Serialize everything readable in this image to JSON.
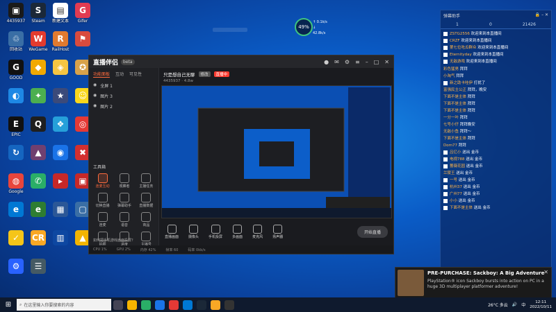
{
  "desktop_icons": [
    {
      "label": "4435937",
      "color": "#1a1a1a",
      "glyph": "▣"
    },
    {
      "label": "Steam",
      "color": "#1b2838",
      "glyph": "S"
    },
    {
      "label": "新建文本",
      "color": "#ffffff",
      "glyph": "▤"
    },
    {
      "label": "Gifer",
      "color": "#e13b52",
      "glyph": "G"
    },
    {
      "label": "回收站",
      "color": "#3a6ea5",
      "glyph": "♲"
    },
    {
      "label": "WeGame",
      "color": "#e33b2e",
      "glyph": "W"
    },
    {
      "label": "RailHost",
      "color": "#e07a2f",
      "glyph": "R"
    },
    {
      "label": "",
      "color": "#d84b3e",
      "glyph": "⚑"
    },
    {
      "label": "GOOD",
      "color": "#111111",
      "glyph": "G"
    },
    {
      "label": "",
      "color": "#f2a900",
      "glyph": "◆"
    },
    {
      "label": "",
      "color": "#f5c542",
      "glyph": "◈"
    },
    {
      "label": "",
      "color": "#d8a24a",
      "glyph": "✪"
    },
    {
      "label": "",
      "color": "#1e88e5",
      "glyph": "◐"
    },
    {
      "label": "",
      "color": "#4caf50",
      "glyph": "✦"
    },
    {
      "label": "",
      "color": "#3b4a7a",
      "glyph": "★"
    },
    {
      "label": "",
      "color": "#f9d71c",
      "glyph": "☺"
    },
    {
      "label": "EPIC",
      "color": "#111111",
      "glyph": "E"
    },
    {
      "label": "",
      "color": "#1f1f1f",
      "glyph": "Q"
    },
    {
      "label": "",
      "color": "#26a0da",
      "glyph": "❖"
    },
    {
      "label": "",
      "color": "#e53935",
      "glyph": "◎"
    },
    {
      "label": "",
      "color": "#1565c0",
      "glyph": "↻"
    },
    {
      "label": "",
      "color": "#e5393577",
      "glyph": "▲"
    },
    {
      "label": "",
      "color": "#1a73e8",
      "glyph": "◉"
    },
    {
      "label": "",
      "color": "#d32f2f",
      "glyph": "✖"
    },
    {
      "label": "Google",
      "color": "#e8453c",
      "glyph": "◍"
    },
    {
      "label": "",
      "color": "#2aae67",
      "glyph": "✆"
    },
    {
      "label": "",
      "color": "#c62828",
      "glyph": "▸"
    },
    {
      "label": "",
      "color": "#c62828",
      "glyph": "▣"
    },
    {
      "label": "",
      "color": "#0078d4",
      "glyph": "e"
    },
    {
      "label": "",
      "color": "#2e7d32",
      "glyph": "e"
    },
    {
      "label": "",
      "color": "#2b5797",
      "glyph": "▦"
    },
    {
      "label": "",
      "color": "#3a6ea5",
      "glyph": "▢"
    },
    {
      "label": "",
      "color": "#f5c518",
      "glyph": "✓"
    },
    {
      "label": "",
      "color": "#f9a825",
      "glyph": "CR"
    },
    {
      "label": "",
      "color": "#0d47a1",
      "glyph": "▥"
    },
    {
      "label": "",
      "color": "#f2b400",
      "glyph": "▲"
    },
    {
      "label": "",
      "color": "#2962ff",
      "glyph": "⚙"
    },
    {
      "label": "",
      "color": "#455a64",
      "glyph": "☰"
    }
  ],
  "perf": {
    "percent": "49%",
    "up": "↑ 0.1k/s",
    "down": "↓ 42.8k/s"
  },
  "app": {
    "logo": "直播伴侣",
    "version": "beta",
    "tabs": [
      "功能面板",
      "互动",
      "可见性"
    ],
    "scenes": [
      "全屏 1",
      "图片 3",
      "图片 2"
    ],
    "tools_title": "工具箱",
    "tools": [
      "连麦互动",
      "观察者",
      "主播任务",
      "切换直播",
      "弹幕助手",
      "直播数据",
      "连麦",
      "语音",
      "商品",
      "拍照",
      "进度",
      "主播号"
    ],
    "channel_title": "只是想自己无聊",
    "tag_live": "直播中",
    "tag_gray": "修改",
    "channel_sub": "4435937 · 4.8w",
    "bottom_buttons": [
      "直播画面",
      "摄像头",
      "手机投屏",
      "多画面",
      "麦克风",
      "扬声器"
    ],
    "start_live": "开始直播",
    "status": [
      "CPU 1%",
      "GPU 2%",
      "内存 42%",
      "帧率 60",
      "码率 0kb/s"
    ],
    "tip": "如何把手机游戏画面投屏？"
  },
  "chat": {
    "header": "弹幕助手",
    "stats": [
      "1",
      "0",
      "21426"
    ],
    "messages": [
      {
        "user": "ZSTG2556",
        "text": "欢迎来到本直播间",
        "sq": true
      },
      {
        "user": "CRZF",
        "text": "欢迎来到本直播间",
        "sq": true
      },
      {
        "user": "第七位吃瓜群众",
        "text": "欢迎来到本直播间",
        "sq": true
      },
      {
        "user": "Eternityday",
        "text": "欢迎来到本直播间",
        "sq": true
      },
      {
        "user": "无敌游戏",
        "text": "欢迎来到本直播间",
        "sq": true
      },
      {
        "user": "",
        "text": "",
        "sq": false
      },
      {
        "user": "彩色猛男",
        "text": "拜拜",
        "sq": false
      },
      {
        "user": "小淘气",
        "text": "拜拜",
        "sq": false
      },
      {
        "user": "新之助卡哇伊",
        "text": "打扰了",
        "sq": true
      },
      {
        "user": "富强民主公正",
        "text": "拜拜，晚安",
        "sq": false
      },
      {
        "user": "下面不是主体",
        "text": "拜拜",
        "sq": false
      },
      {
        "user": "下面不是主体",
        "text": "拜拜",
        "sq": false
      },
      {
        "user": "下面不是主体",
        "text": "拜拜",
        "sq": false
      },
      {
        "user": "一分一叶",
        "text": "拜拜",
        "sq": false
      },
      {
        "user": "七号小仔",
        "text": "拜拜晚安",
        "sq": false
      },
      {
        "user": "无敌小鱼",
        "text": "拜拜～",
        "sq": false
      },
      {
        "user": "下面不是主体",
        "text": "拜拜",
        "sq": false
      },
      {
        "user": "Dom77",
        "text": "拜拜",
        "sq": false
      },
      {
        "user": "吕亿小",
        "text": "送出 金币",
        "sq": true
      },
      {
        "user": "电视788",
        "text": "送出 金币",
        "sq": true
      },
      {
        "user": "蔷薇花园",
        "text": "送出 金币",
        "sq": true
      },
      {
        "user": "兰陵王",
        "text": "送出 金币",
        "sq": false
      },
      {
        "user": "一号",
        "text": "送出 金币",
        "sq": true
      },
      {
        "user": "杭州37",
        "text": "送出 金币",
        "sq": true
      },
      {
        "user": "广州77",
        "text": "送出 金币",
        "sq": true
      },
      {
        "user": "小小",
        "text": "送出 金币",
        "sq": true
      },
      {
        "user": "下面不是主体",
        "text": "送出 金币",
        "sq": true
      }
    ]
  },
  "notification": {
    "title": "PRE-PURCHASE: Sackboy: A Big Adventure",
    "body": "PlayStation® icon Sackboy bursts into action on PC in a huge 3D multiplayer platformer adventure!"
  },
  "taskbar": {
    "search_placeholder": "在这里输入你要搜索的内容",
    "weather": "26°C 多云",
    "time": "12:11",
    "date": "2022/10/11",
    "lang": "中"
  }
}
